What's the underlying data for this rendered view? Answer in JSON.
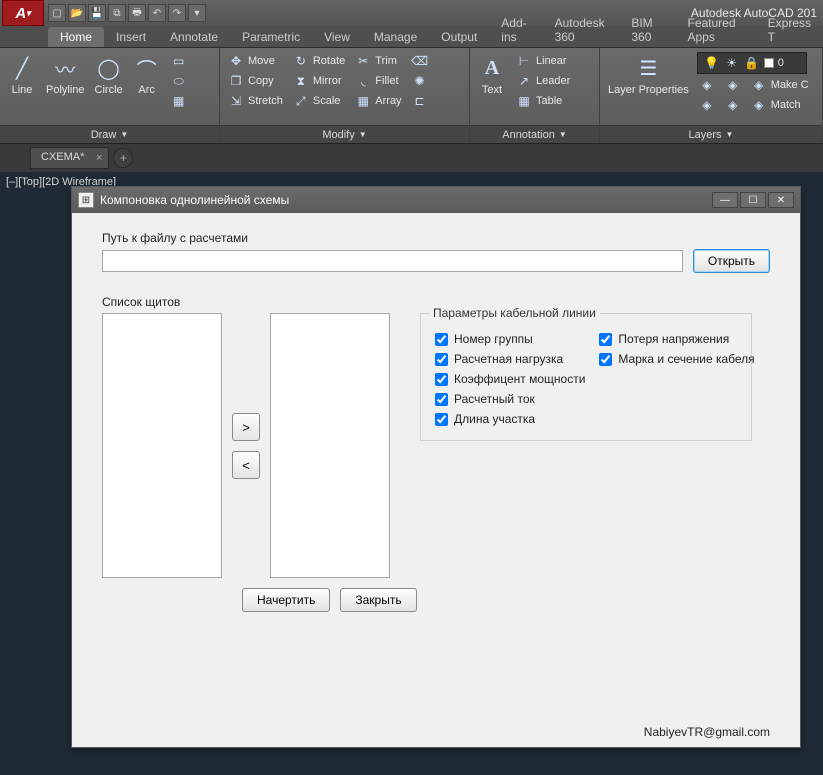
{
  "app_title": "Autodesk AutoCAD 201",
  "qat_icons": [
    "new",
    "open",
    "save",
    "saveall",
    "print",
    "undo",
    "redo"
  ],
  "ribbon_tabs": [
    "Home",
    "Insert",
    "Annotate",
    "Parametric",
    "View",
    "Manage",
    "Output",
    "Add-ins",
    "Autodesk 360",
    "BIM 360",
    "Featured Apps",
    "Express T"
  ],
  "ribbon_active_tab": "Home",
  "panels": {
    "draw": {
      "title": "Draw",
      "tools_big": [
        "Line",
        "Polyline",
        "Circle",
        "Arc"
      ]
    },
    "modify": {
      "title": "Modify",
      "rows": [
        [
          "Move",
          "Rotate",
          "Trim"
        ],
        [
          "Copy",
          "Mirror",
          "Fillet"
        ],
        [
          "Stretch",
          "Scale",
          "Array"
        ]
      ]
    },
    "annotation": {
      "title": "Annotation",
      "text": "Text",
      "rows": [
        "Linear",
        "Leader",
        "Table"
      ]
    },
    "layers": {
      "title": "Layers",
      "props": "Layer\nProperties",
      "state": "0",
      "make": "Make C",
      "match": "Match"
    }
  },
  "doc_tab": "CXEMA*",
  "view_label": "[–][Top][2D Wireframe]",
  "dialog": {
    "title": "Компоновка однолинейной схемы",
    "path_label": "Путь к файлу с расчетами",
    "path_value": "",
    "open_btn": "Открыть",
    "list_label": "Список щитов",
    "move_right": ">",
    "move_left": "<",
    "params_legend": "Параметры кабельной линии",
    "checks": {
      "group_no": "Номер группы",
      "voltage_drop": "Потеря напряжения",
      "calc_load": "Расчетная нагрузка",
      "cable_brand": "Марка и сечение кабеля",
      "power_factor": "Коэффицент мощности",
      "calc_current": "Расчетный ток",
      "section_len": "Длина участка"
    },
    "draw_btn": "Начертить",
    "close_btn": "Закрыть",
    "email": "NabiyevTR@gmail.com"
  }
}
